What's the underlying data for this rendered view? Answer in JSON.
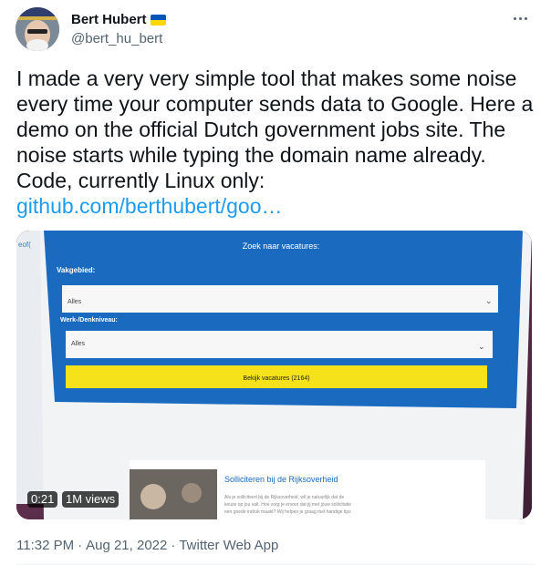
{
  "author": {
    "display_name": "Bert Hubert",
    "handle": "@bert_hu_bert",
    "flag_icon": "ukraine-flag-icon"
  },
  "tweet": {
    "text": "I made a very very simple tool that makes some noise every time your computer sends data to Google. Here a demo on the official Dutch government jobs site. The noise starts while typing the domain name already. Code, currently Linux only: ",
    "link_text": "github.com/berthubert/goo…"
  },
  "video": {
    "duration": "0:21",
    "views": "1M views",
    "frame": {
      "code_fragment": "eof(",
      "search_title": "Zoek naar vacatures:",
      "field1_label": "Vakgebied:",
      "field1_value": "Alles",
      "field2_label": "Werk-/Denkniveau:",
      "field2_value": "Alles",
      "button_label": "Bekijk vacatures (2164)",
      "card_title": "Solliciteren bij de Rijksoverheid",
      "card_line1": "Als je solliciteert bij de Rijksoverheid, wil je natuurlijk dat de",
      "card_line2": "keuze op jou valt. Hoe zorg je ervoor dat jij met jouw sollicitatie",
      "card_line3": "een goede indruk maakt? Wij helpen je graag met handige tips"
    }
  },
  "meta": {
    "time": "11:32 PM",
    "sep1": "·",
    "date": "Aug 21, 2022",
    "sep2": "·",
    "source": "Twitter Web App"
  },
  "colors": {
    "link": "#1d9bf0",
    "muted": "#536471",
    "site_blue": "#1a6bbf",
    "site_yellow": "#f5e21b"
  }
}
